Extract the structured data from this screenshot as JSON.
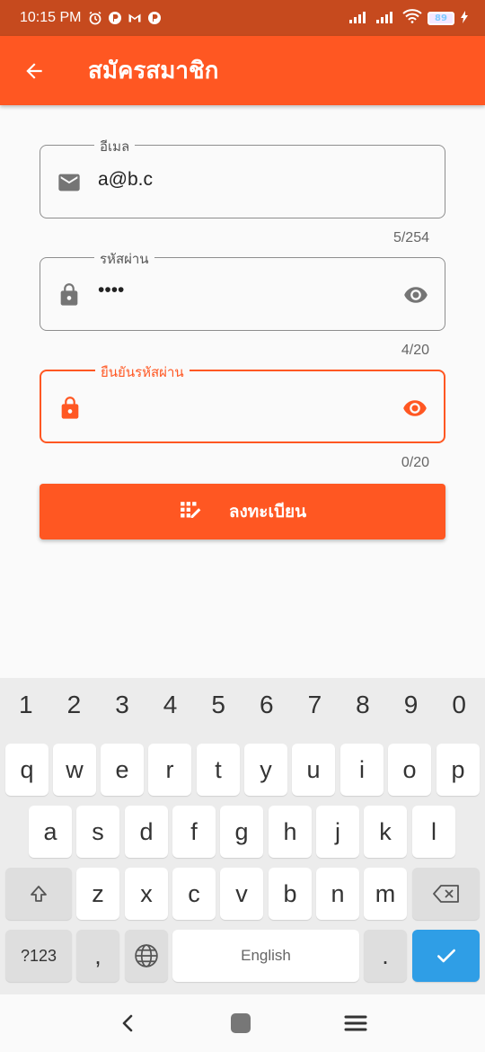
{
  "status_bar": {
    "time": "10:15 PM",
    "battery": "89"
  },
  "app_bar": {
    "title": "สมัครสมาชิก"
  },
  "fields": {
    "email": {
      "label": "อีเมล",
      "value": "a@b.c",
      "counter": "5/254"
    },
    "password": {
      "label": "รหัสผ่าน",
      "value": "••••",
      "counter": "4/20"
    },
    "confirm_password": {
      "label": "ยืนยันรหัสผ่าน",
      "value": "",
      "counter": "0/20"
    }
  },
  "register_button": {
    "label": "ลงทะเบียน"
  },
  "keyboard": {
    "numbers": [
      "1",
      "2",
      "3",
      "4",
      "5",
      "6",
      "7",
      "8",
      "9",
      "0"
    ],
    "row1": [
      "q",
      "w",
      "e",
      "r",
      "t",
      "y",
      "u",
      "i",
      "o",
      "p"
    ],
    "row2": [
      "a",
      "s",
      "d",
      "f",
      "g",
      "h",
      "j",
      "k",
      "l"
    ],
    "row3": [
      "z",
      "x",
      "c",
      "v",
      "b",
      "n",
      "m"
    ],
    "symbols_label": "?123",
    "comma": ",",
    "space_label": "English",
    "period": "."
  },
  "colors": {
    "primary": "#ff5722",
    "status_bar": "#c64a1e",
    "enter_key": "#2f9ee6"
  }
}
